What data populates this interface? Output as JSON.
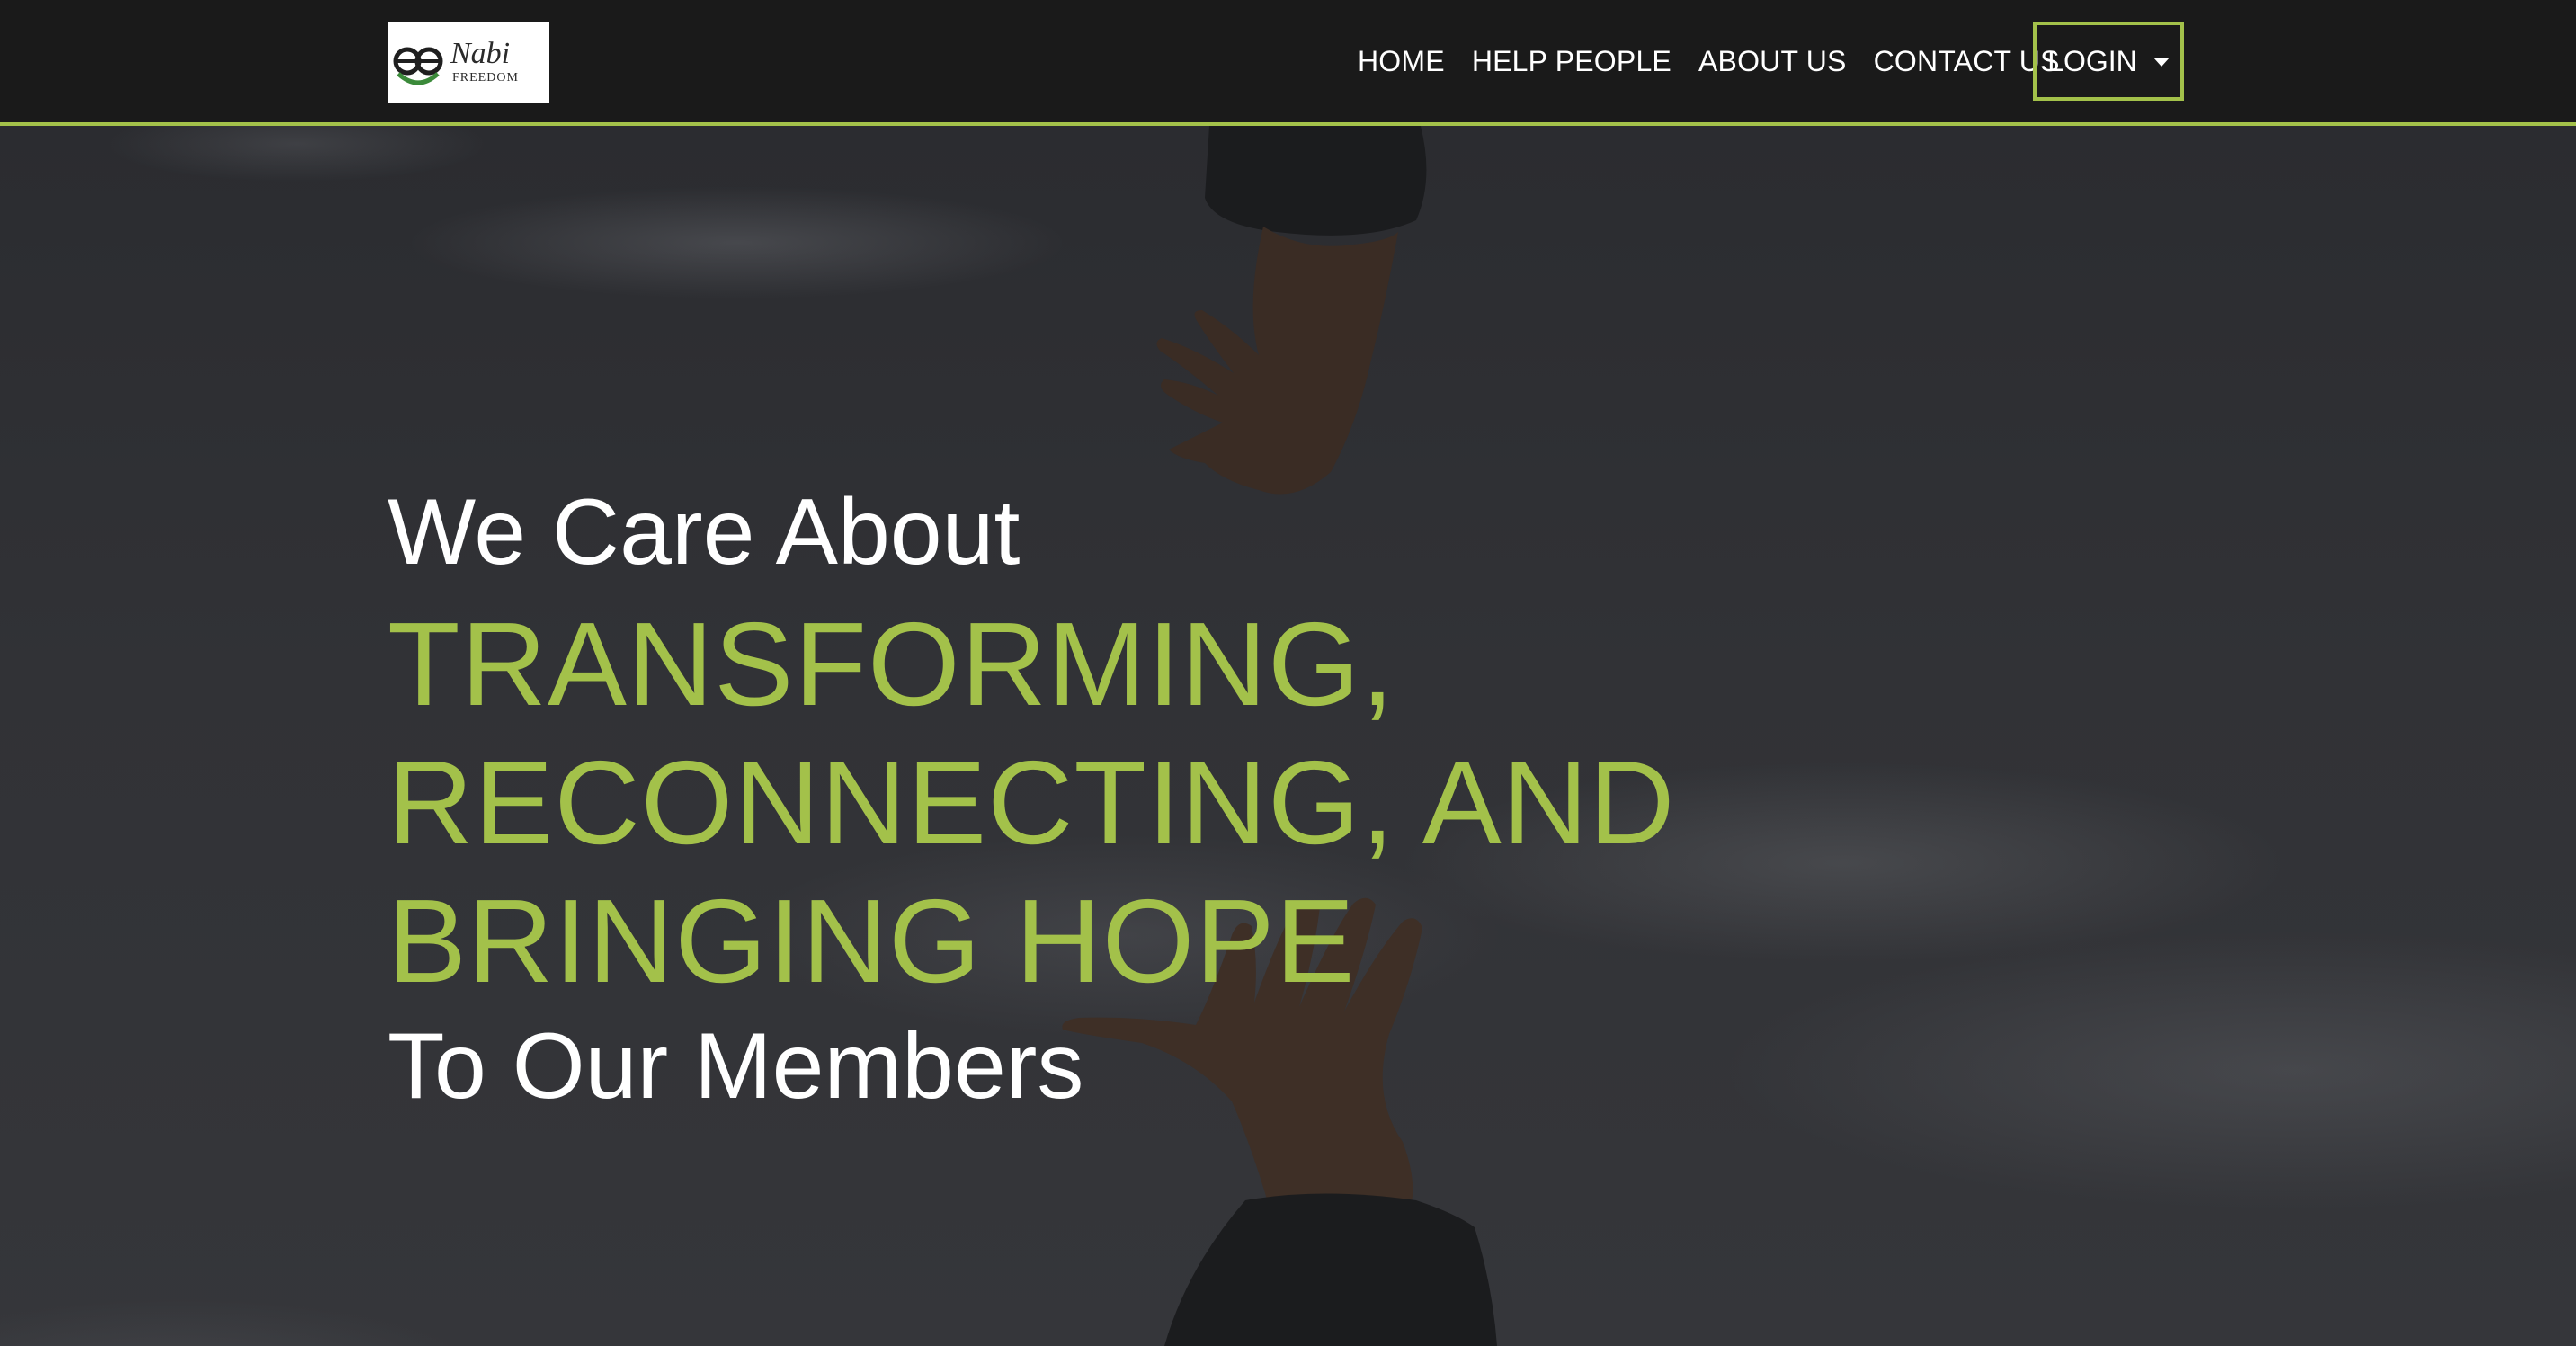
{
  "brand": {
    "logo_name": "Nabi",
    "logo_tagline": "FREEDOM"
  },
  "nav": {
    "items": [
      {
        "label": "HOME"
      },
      {
        "label": "HELP PEOPLE"
      },
      {
        "label": "ABOUT US"
      },
      {
        "label": "CONTACT US"
      }
    ],
    "login_label": "LOGIN"
  },
  "hero": {
    "intro": "We Care About",
    "highlight": "TRANSFORMING, RECONNECTING, AND BRINGING HOPE",
    "outro": "To Our Members"
  },
  "colors": {
    "accent": "#a3c14a",
    "navbar_bg": "#1a1a1a",
    "text": "#ffffff"
  }
}
